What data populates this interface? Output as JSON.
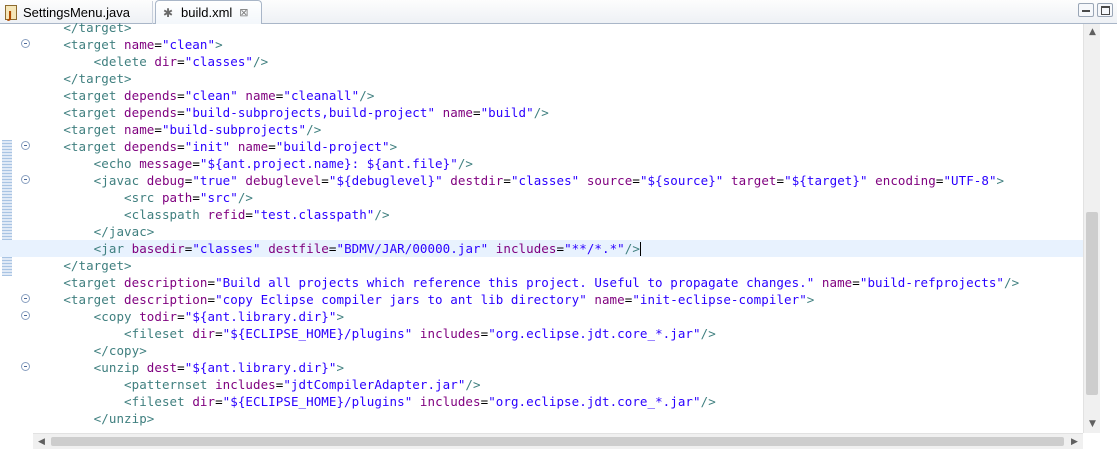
{
  "tabs": [
    {
      "label": "SettingsMenu.java",
      "icon": "java-file-icon",
      "active": false
    },
    {
      "label": "build.xml",
      "icon": "ant-file-icon",
      "active": true
    }
  ],
  "tab_close_glyph": "⊠",
  "editor": {
    "current_line_index": 13,
    "lines": [
      {
        "fold": false,
        "tokens": [
          [
            "t",
            "    </target>"
          ]
        ]
      },
      {
        "fold": true,
        "tokens": [
          [
            "t",
            "    <target "
          ],
          [
            "a",
            "name"
          ],
          [
            "o",
            "="
          ],
          [
            "v",
            "\"clean\""
          ],
          [
            "t",
            ">"
          ]
        ]
      },
      {
        "fold": false,
        "tokens": [
          [
            "t",
            "        <delete "
          ],
          [
            "a",
            "dir"
          ],
          [
            "o",
            "="
          ],
          [
            "v",
            "\"classes\""
          ],
          [
            "t",
            "/>"
          ]
        ]
      },
      {
        "fold": false,
        "tokens": [
          [
            "t",
            "    </target>"
          ]
        ]
      },
      {
        "fold": false,
        "tokens": [
          [
            "t",
            "    <target "
          ],
          [
            "a",
            "depends"
          ],
          [
            "o",
            "="
          ],
          [
            "v",
            "\"clean\""
          ],
          [
            "a",
            " name"
          ],
          [
            "o",
            "="
          ],
          [
            "v",
            "\"cleanall\""
          ],
          [
            "t",
            "/>"
          ]
        ]
      },
      {
        "fold": false,
        "tokens": [
          [
            "t",
            "    <target "
          ],
          [
            "a",
            "depends"
          ],
          [
            "o",
            "="
          ],
          [
            "v",
            "\"build-subprojects,build-project\""
          ],
          [
            "a",
            " name"
          ],
          [
            "o",
            "="
          ],
          [
            "v",
            "\"build\""
          ],
          [
            "t",
            "/>"
          ]
        ]
      },
      {
        "fold": false,
        "tokens": [
          [
            "t",
            "    <target "
          ],
          [
            "a",
            "name"
          ],
          [
            "o",
            "="
          ],
          [
            "v",
            "\"build-subprojects\""
          ],
          [
            "t",
            "/>"
          ]
        ]
      },
      {
        "fold": true,
        "tokens": [
          [
            "t",
            "    <target "
          ],
          [
            "a",
            "depends"
          ],
          [
            "o",
            "="
          ],
          [
            "v",
            "\"init\""
          ],
          [
            "a",
            " name"
          ],
          [
            "o",
            "="
          ],
          [
            "v",
            "\"build-project\""
          ],
          [
            "t",
            ">"
          ]
        ]
      },
      {
        "fold": false,
        "tokens": [
          [
            "t",
            "        <echo "
          ],
          [
            "a",
            "message"
          ],
          [
            "o",
            "="
          ],
          [
            "v",
            "\"${ant.project.name}: ${ant.file}\""
          ],
          [
            "t",
            "/>"
          ]
        ]
      },
      {
        "fold": true,
        "tokens": [
          [
            "t",
            "        <javac "
          ],
          [
            "a",
            "debug"
          ],
          [
            "o",
            "="
          ],
          [
            "v",
            "\"true\""
          ],
          [
            "a",
            " debuglevel"
          ],
          [
            "o",
            "="
          ],
          [
            "v",
            "\"${debuglevel}\""
          ],
          [
            "a",
            " destdir"
          ],
          [
            "o",
            "="
          ],
          [
            "v",
            "\"classes\""
          ],
          [
            "a",
            " source"
          ],
          [
            "o",
            "="
          ],
          [
            "v",
            "\"${source}\""
          ],
          [
            "a",
            " target"
          ],
          [
            "o",
            "="
          ],
          [
            "v",
            "\"${target}\""
          ],
          [
            "a",
            " encoding"
          ],
          [
            "o",
            "="
          ],
          [
            "v",
            "\"UTF-8\""
          ],
          [
            "t",
            ">"
          ]
        ]
      },
      {
        "fold": false,
        "tokens": [
          [
            "t",
            "            <src "
          ],
          [
            "a",
            "path"
          ],
          [
            "o",
            "="
          ],
          [
            "v",
            "\"src\""
          ],
          [
            "t",
            "/>"
          ]
        ]
      },
      {
        "fold": false,
        "tokens": [
          [
            "t",
            "            <classpath "
          ],
          [
            "a",
            "refid"
          ],
          [
            "o",
            "="
          ],
          [
            "v",
            "\"test.classpath\""
          ],
          [
            "t",
            "/>"
          ]
        ]
      },
      {
        "fold": false,
        "tokens": [
          [
            "t",
            "        </javac>"
          ]
        ]
      },
      {
        "fold": false,
        "tokens": [
          [
            "t",
            "        <jar "
          ],
          [
            "a",
            "basedir"
          ],
          [
            "o",
            "="
          ],
          [
            "v",
            "\"classes\""
          ],
          [
            "a",
            " destfile"
          ],
          [
            "o",
            "="
          ],
          [
            "v",
            "\"BDMV/JAR/00000.jar\""
          ],
          [
            "a",
            " includes"
          ],
          [
            "o",
            "="
          ],
          [
            "v",
            "\"**/*.*\""
          ],
          [
            "t",
            "/>"
          ]
        ]
      },
      {
        "fold": false,
        "tokens": [
          [
            "t",
            "    </target>"
          ]
        ]
      },
      {
        "fold": false,
        "tokens": [
          [
            "t",
            "    <target "
          ],
          [
            "a",
            "description"
          ],
          [
            "o",
            "="
          ],
          [
            "v",
            "\"Build all projects which reference this project. Useful to propagate changes.\""
          ],
          [
            "a",
            " name"
          ],
          [
            "o",
            "="
          ],
          [
            "v",
            "\"build-refprojects\""
          ],
          [
            "t",
            "/>"
          ]
        ]
      },
      {
        "fold": true,
        "tokens": [
          [
            "t",
            "    <target "
          ],
          [
            "a",
            "description"
          ],
          [
            "o",
            "="
          ],
          [
            "v",
            "\"copy Eclipse compiler jars to ant lib directory\""
          ],
          [
            "a",
            " name"
          ],
          [
            "o",
            "="
          ],
          [
            "v",
            "\"init-eclipse-compiler\""
          ],
          [
            "t",
            ">"
          ]
        ]
      },
      {
        "fold": true,
        "tokens": [
          [
            "t",
            "        <copy "
          ],
          [
            "a",
            "todir"
          ],
          [
            "o",
            "="
          ],
          [
            "v",
            "\"${ant.library.dir}\""
          ],
          [
            "t",
            ">"
          ]
        ]
      },
      {
        "fold": false,
        "tokens": [
          [
            "t",
            "            <fileset "
          ],
          [
            "a",
            "dir"
          ],
          [
            "o",
            "="
          ],
          [
            "v",
            "\"${ECLIPSE_HOME}/plugins\""
          ],
          [
            "a",
            " includes"
          ],
          [
            "o",
            "="
          ],
          [
            "v",
            "\"org.eclipse.jdt.core_*.jar\""
          ],
          [
            "t",
            "/>"
          ]
        ]
      },
      {
        "fold": false,
        "tokens": [
          [
            "t",
            "        </copy>"
          ]
        ]
      },
      {
        "fold": true,
        "tokens": [
          [
            "t",
            "        <unzip "
          ],
          [
            "a",
            "dest"
          ],
          [
            "o",
            "="
          ],
          [
            "v",
            "\"${ant.library.dir}\""
          ],
          [
            "t",
            ">"
          ]
        ]
      },
      {
        "fold": false,
        "tokens": [
          [
            "t",
            "            <patternset "
          ],
          [
            "a",
            "includes"
          ],
          [
            "o",
            "="
          ],
          [
            "v",
            "\"jdtCompilerAdapter.jar\""
          ],
          [
            "t",
            "/>"
          ]
        ]
      },
      {
        "fold": false,
        "tokens": [
          [
            "t",
            "            <fileset "
          ],
          [
            "a",
            "dir"
          ],
          [
            "o",
            "="
          ],
          [
            "v",
            "\"${ECLIPSE_HOME}/plugins\""
          ],
          [
            "a",
            " includes"
          ],
          [
            "o",
            "="
          ],
          [
            "v",
            "\"org.eclipse.jdt.core_*.jar\""
          ],
          [
            "t",
            "/>"
          ]
        ]
      },
      {
        "fold": false,
        "tokens": [
          [
            "t",
            "        </unzip>"
          ]
        ]
      }
    ]
  },
  "colors": {
    "tag": "#3f7f7f",
    "attribute": "#7f007f",
    "value": "#2a00ff",
    "current_line": "#e8f2fe"
  },
  "scrollbar": {
    "up_arrow": "▲",
    "down_arrow": "▼",
    "left_arrow": "◀",
    "right_arrow": "▶"
  }
}
